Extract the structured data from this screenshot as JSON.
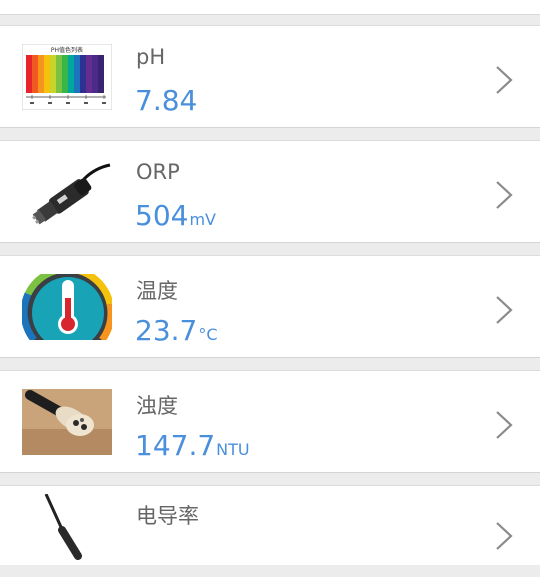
{
  "top_partial_value": " ",
  "sensors": [
    {
      "name": "pH",
      "value": "7.84",
      "unit": "",
      "icon": "ph-color-chart-icon"
    },
    {
      "name": "ORP",
      "value": "504",
      "unit": "mV",
      "icon": "orp-probe-icon"
    },
    {
      "name": "温度",
      "value": "23.7",
      "unit": "°C",
      "icon": "thermometer-icon"
    },
    {
      "name": "浊度",
      "value": "147.7",
      "unit": "NTU",
      "icon": "turbidity-probe-icon"
    },
    {
      "name": "电导率",
      "value": "",
      "unit": "",
      "icon": "conductivity-probe-icon"
    }
  ],
  "ph_chart_title": "PH值色列表",
  "colors": {
    "value_blue": "#4a8fdb",
    "label_gray": "#666666",
    "chevron_gray": "#8a8a8a"
  }
}
